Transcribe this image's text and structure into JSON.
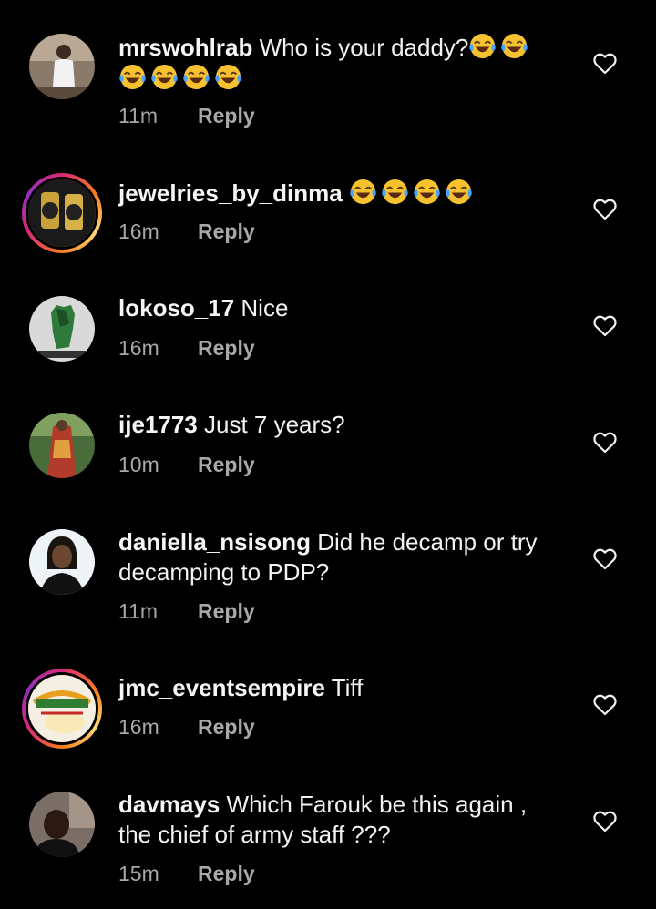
{
  "comments": [
    {
      "username": "mrswohlrab",
      "text": "Who is your daddy?",
      "emoji_count": 6,
      "emoji_icon": "face-with-tears-of-joy-emoji",
      "time": "11m",
      "reply_label": "Reply",
      "story_ring": false
    },
    {
      "username": "jewelries_by_dinma",
      "text": "",
      "emoji_count": 4,
      "emoji_icon": "face-with-tears-of-joy-emoji",
      "time": "16m",
      "reply_label": "Reply",
      "story_ring": true
    },
    {
      "username": "lokoso_17",
      "text": "Nice",
      "emoji_count": 0,
      "time": "16m",
      "reply_label": "Reply",
      "story_ring": false
    },
    {
      "username": "ije1773",
      "text": "Just 7 years?",
      "emoji_count": 0,
      "time": "10m",
      "reply_label": "Reply",
      "story_ring": false
    },
    {
      "username": "daniella_nsisong",
      "text": "Did he decamp or try decamping to PDP?",
      "emoji_count": 0,
      "time": "11m",
      "reply_label": "Reply",
      "story_ring": false
    },
    {
      "username": "jmc_eventsempire",
      "text": "Tiff",
      "emoji_count": 0,
      "time": "16m",
      "reply_label": "Reply",
      "story_ring": true
    },
    {
      "username": "davmays",
      "text": "Which Farouk be this again , the chief of army staff ???",
      "emoji_count": 0,
      "time": "15m",
      "reply_label": "Reply",
      "story_ring": false
    }
  ],
  "icons": {
    "like": "heart-outline-icon",
    "emoji": "face-with-tears-of-joy-emoji"
  },
  "colors": {
    "background": "#000000",
    "text": "#f5f5f5",
    "meta": "#a8a8a8",
    "emoji_face": "#f7c12f",
    "emoji_tears": "#4aa3ff"
  }
}
